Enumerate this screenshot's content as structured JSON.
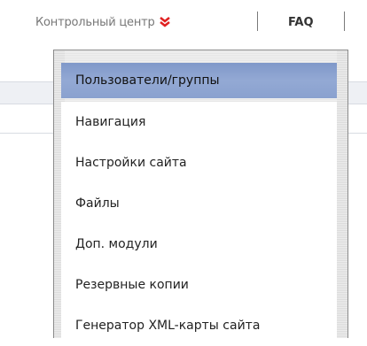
{
  "topnav": {
    "control_center_label": "Контрольный центр",
    "faq_label": "FAQ",
    "chevron_icon": "double-chevron-down-icon",
    "chevron_color": "#e02020"
  },
  "dropdown": {
    "items": [
      {
        "label": "Пользователи/группы",
        "active": true
      },
      {
        "label": "Навигация",
        "active": false
      },
      {
        "label": "Настройки сайта",
        "active": false
      },
      {
        "label": "Файлы",
        "active": false
      },
      {
        "label": "Доп. модули",
        "active": false
      },
      {
        "label": "Резервные копии",
        "active": false
      },
      {
        "label": "Генератор XML-карты сайта",
        "active": false
      }
    ],
    "highlight_color": "#8aa1cf"
  }
}
